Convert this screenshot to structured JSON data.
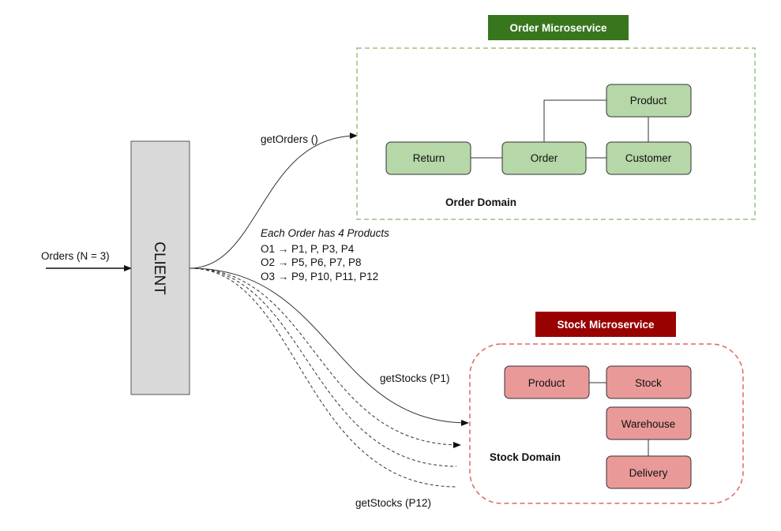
{
  "client": {
    "label": "CLIENT"
  },
  "input": {
    "label": "Orders (N = 3)"
  },
  "order_service": {
    "title": "Order Microservice",
    "title_color": "#38761d",
    "domain_label": "Order Domain",
    "entities": {
      "product": "Product",
      "return": "Return",
      "order": "Order",
      "customer": "Customer"
    }
  },
  "stock_service": {
    "title": "Stock Microservice",
    "title_color": "#990000",
    "domain_label": "Stock Domain",
    "entities": {
      "product": "Product",
      "stock": "Stock",
      "warehouse": "Warehouse",
      "delivery": "Delivery"
    }
  },
  "calls": {
    "get_orders": "getOrders ()",
    "get_stocks_first": "getStocks (P1)",
    "get_stocks_last": "getStocks (P12)"
  },
  "note": {
    "title": "Each Order has 4 Products",
    "lines": [
      "O1 → P1, P, P3, P4",
      "O2 → P5, P6, P7, P8",
      "O3 → P9, P10, P11, P12"
    ]
  }
}
